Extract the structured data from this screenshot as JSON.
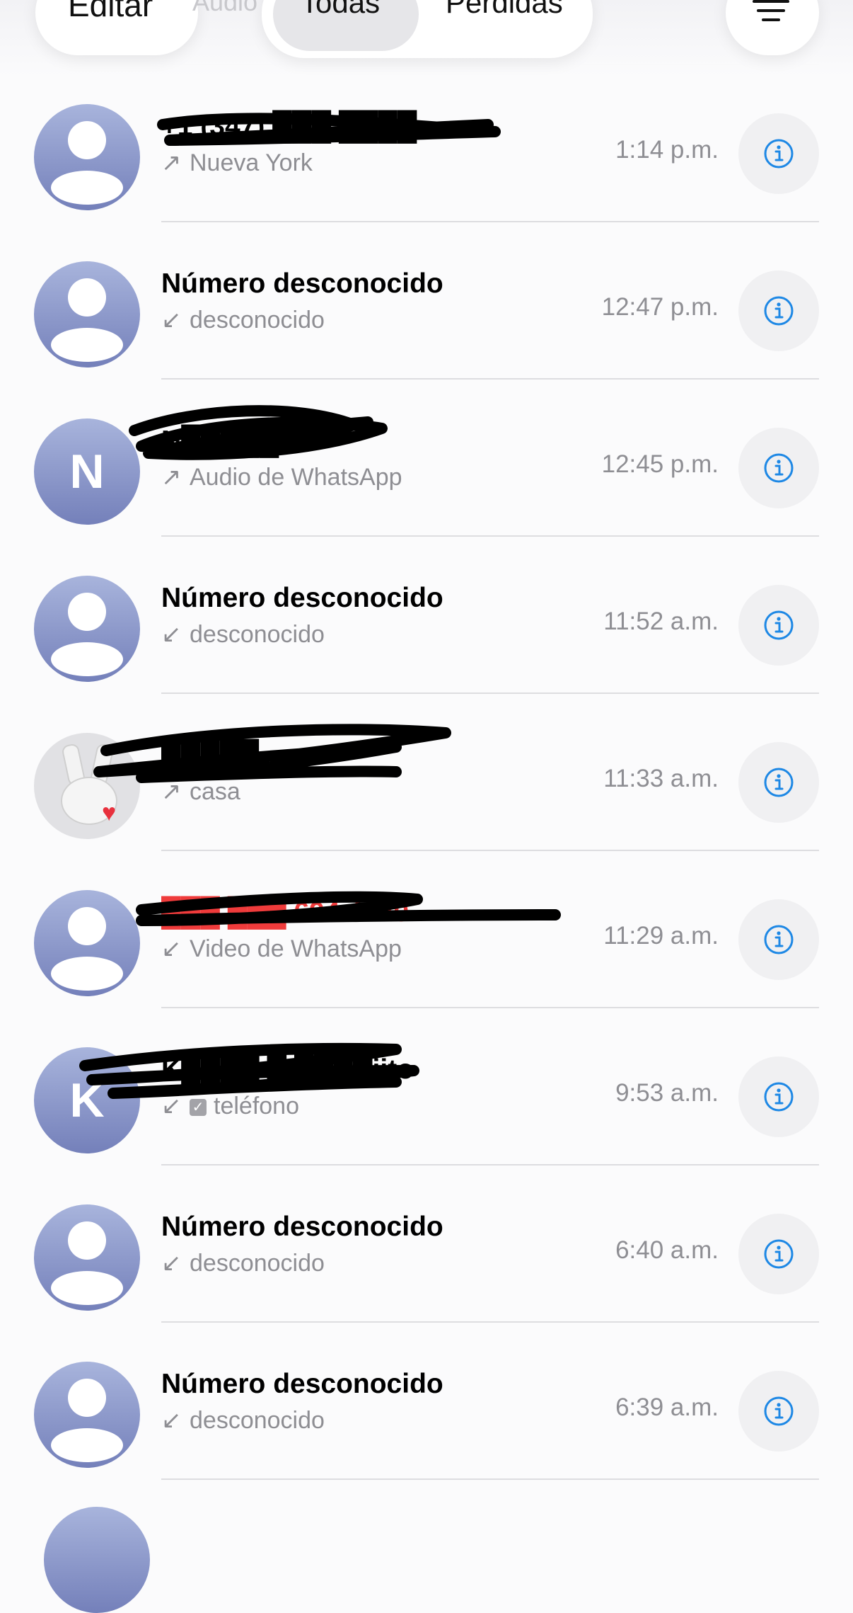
{
  "toolbar": {
    "edit_label": "Editar",
    "ghost_label": "Audio",
    "segments": [
      "Todas",
      "Perdidas"
    ],
    "selected_segment": "Todas",
    "filter_icon": "filter-lines-icon"
  },
  "colors": {
    "accent": "#1e88e5",
    "missed": "#ef3b3b",
    "secondary_text": "#8e8e93",
    "avatar_gradient_top": "#a8b4dc",
    "avatar_gradient_bottom": "#7480ba"
  },
  "calls": [
    {
      "name": "+1 (347) ███ ████",
      "direction": "outgoing",
      "detail": "Nueva York",
      "time": "1:14 p.m.",
      "avatar": "person",
      "redacted": true
    },
    {
      "name": "Número desconocido",
      "direction": "incoming",
      "detail": "desconocido",
      "time": "12:47 p.m.",
      "avatar": "person",
      "redacted": false
    },
    {
      "name": "N█████",
      "direction": "outgoing",
      "detail": "Audio de WhatsApp",
      "time": "12:45 p.m.",
      "avatar": "N",
      "redacted": true
    },
    {
      "name": "Número desconocido",
      "direction": "incoming",
      "detail": "desconocido",
      "time": "11:52 a.m.",
      "avatar": "person",
      "redacted": false
    },
    {
      "name": "█████",
      "direction": "outgoing",
      "detail": "casa",
      "time": "11:33 a.m.",
      "avatar": "memoji-bunny",
      "redacted": true
    },
    {
      "name": "███ ███ 694 4180",
      "direction": "incoming",
      "detail": "Video de WhatsApp",
      "time": "11:29 a.m.",
      "avatar": "person",
      "redacted": true,
      "missed": true
    },
    {
      "name": "K████ █ ████jito",
      "direction": "incoming",
      "detail": "teléfono",
      "time": "9:53 a.m.",
      "avatar": "K",
      "redacted": true,
      "verified": true
    },
    {
      "name": "Número desconocido",
      "direction": "incoming",
      "detail": "desconocido",
      "time": "6:40 a.m.",
      "avatar": "person",
      "redacted": false
    },
    {
      "name": "Número desconocido",
      "direction": "incoming",
      "detail": "desconocido",
      "time": "6:39 a.m.",
      "avatar": "person",
      "redacted": false
    }
  ]
}
